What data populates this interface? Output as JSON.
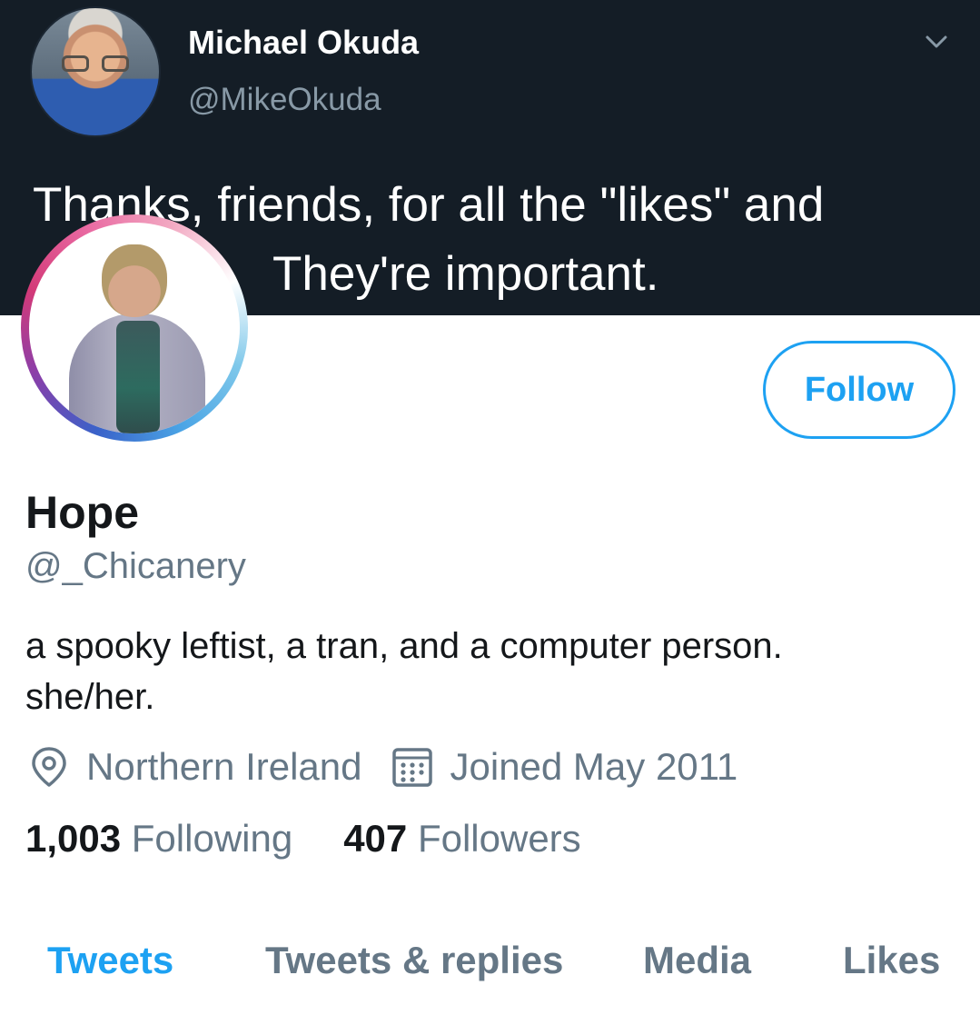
{
  "quoted_tweet": {
    "author_name": "Michael Okuda",
    "author_handle": "@MikeOkuda",
    "text_line1": "Thanks, friends, for all the \"likes\" and",
    "text_line2": "They're important."
  },
  "profile": {
    "follow_label": "Follow",
    "display_name": "Hope",
    "handle": "@_Chicanery",
    "bio": "a spooky leftist, a tran, and a computer person.\nshe/her.",
    "location": "Northern Ireland",
    "joined": "Joined May 2011",
    "following_count": "1,003",
    "following_label": "Following",
    "followers_count": "407",
    "followers_label": "Followers"
  },
  "tabs": [
    {
      "label": "Tweets",
      "active": true
    },
    {
      "label": "Tweets & replies",
      "active": false
    },
    {
      "label": "Media",
      "active": false
    },
    {
      "label": "Likes",
      "active": false
    }
  ],
  "colors": {
    "accent": "#1da1f2",
    "banner": "#141d26",
    "secondary_text": "#657786",
    "primary_text": "#14171a"
  },
  "icons": [
    "chevron-down-icon",
    "location-pin-icon",
    "calendar-icon"
  ]
}
